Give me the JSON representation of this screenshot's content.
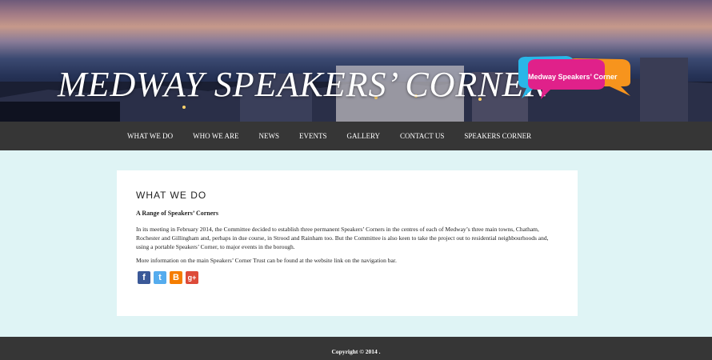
{
  "header": {
    "title": "MEDWAY SPEAKERS’ CORNER",
    "logo_text": "Medway Speakers’ Corner"
  },
  "nav": {
    "items": [
      "WHAT WE DO",
      "WHO WE ARE",
      "NEWS",
      "EVENTS",
      "GALLERY",
      "CONTACT US",
      "SPEAKERS CORNER"
    ]
  },
  "content": {
    "heading": "WHAT WE DO",
    "subheading": "A Range of Speakers’ Corners",
    "paragraph1": "In its meeting in February 2014, the Committee decided to establish three permanent Speakers’ Corners in the centres of each of Medway’s three main towns, Chatham, Rochester and Gillingham and, perhaps in due course, in Strood and Rainham too. But the Committee is also keen to take the project out to residential neighbourhoods and, using a portable Speakers’ Corner, to major events in the borough.",
    "paragraph2": "More information on the main Speakers’ Corner Trust can be found at the website link on the navigation bar."
  },
  "social": [
    {
      "icon": "facebook-icon",
      "glyph": "f"
    },
    {
      "icon": "twitter-icon",
      "glyph": "t"
    },
    {
      "icon": "blogger-icon",
      "glyph": "B"
    },
    {
      "icon": "google-plus-icon",
      "glyph": "g+"
    }
  ],
  "footer": {
    "copyright": "Copyright © 2014 ."
  },
  "colors": {
    "page_bg": "#dff4f5",
    "nav_bg": "#363636",
    "bubble_blue": "#29b6e8",
    "bubble_pink": "#e0218a",
    "bubble_orange": "#f7941d"
  }
}
